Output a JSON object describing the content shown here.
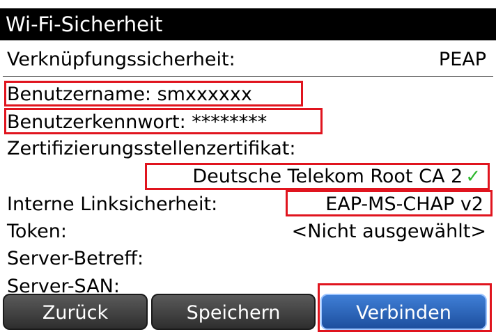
{
  "title": "Wi-Fi-Sicherheit",
  "fields": {
    "link_security_label": "Verknüpfungssicherheit:",
    "link_security_value": "PEAP",
    "username": "Benutzername: smxxxxxx",
    "password": "Benutzerkennwort: ********",
    "ca_cert_label": "Zertifizierungsstellenzertifikat:",
    "ca_cert_value": "Deutsche Telekom Root CA 2",
    "inner_link_label": "Interne Linksicherheit:",
    "inner_link_value": "EAP-MS-CHAP v2",
    "token_label": "Token:",
    "token_value": "<Nicht ausgewählt>",
    "server_subject_label": "Server-Betreff:",
    "server_san_label": "Server-SAN:"
  },
  "buttons": {
    "back": "Zurück",
    "save": "Speichern",
    "connect": "Verbinden"
  },
  "colors": {
    "highlight": "#e0141e",
    "check": "#2eb82e",
    "connect_button": "#1d4f9e"
  },
  "icons": {
    "check": "✓"
  }
}
